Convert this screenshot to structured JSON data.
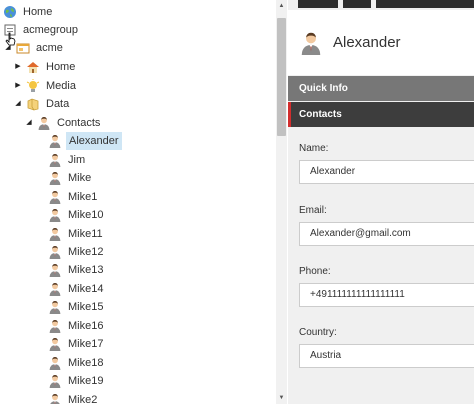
{
  "tree": {
    "items": [
      {
        "label": "Home",
        "icon": "globe-icon"
      },
      {
        "label": "acmegroup",
        "icon": "page-icon"
      },
      {
        "label": "acme",
        "icon": "site-icon"
      },
      {
        "label": "Home",
        "icon": "house-icon"
      },
      {
        "label": "Media",
        "icon": "media-icon"
      },
      {
        "label": "Data",
        "icon": "data-icon"
      },
      {
        "label": "Contacts",
        "icon": "person-icon"
      },
      {
        "label": "Alexander",
        "icon": "person-icon"
      },
      {
        "label": "Jim",
        "icon": "person-icon"
      },
      {
        "label": "Mike",
        "icon": "person-icon"
      },
      {
        "label": "Mike1",
        "icon": "person-icon"
      },
      {
        "label": "Mike10",
        "icon": "person-icon"
      },
      {
        "label": "Mike11",
        "icon": "person-icon"
      },
      {
        "label": "Mike12",
        "icon": "person-icon"
      },
      {
        "label": "Mike13",
        "icon": "person-icon"
      },
      {
        "label": "Mike14",
        "icon": "person-icon"
      },
      {
        "label": "Mike15",
        "icon": "person-icon"
      },
      {
        "label": "Mike16",
        "icon": "person-icon"
      },
      {
        "label": "Mike17",
        "icon": "person-icon"
      },
      {
        "label": "Mike18",
        "icon": "person-icon"
      },
      {
        "label": "Mike19",
        "icon": "person-icon"
      },
      {
        "label": "Mike2",
        "icon": "person-icon"
      }
    ],
    "selected": "Alexander"
  },
  "editor": {
    "header_name": "Alexander",
    "sections": {
      "quick_info": "Quick Info",
      "contacts": "Contacts"
    },
    "fields": {
      "name_label": "Name:",
      "name_value": "Alexander",
      "email_label": "Email:",
      "email_value": "Alexander@gmail.com",
      "phone_label": "Phone:",
      "phone_value": "+491111111111111111",
      "country_label": "Country:",
      "country_value": "Austria"
    }
  },
  "colors": {
    "accent": "#d22d2d",
    "selection": "#cfe6f5",
    "section_dark": "#3d3d3d",
    "section_grey": "#777777"
  }
}
